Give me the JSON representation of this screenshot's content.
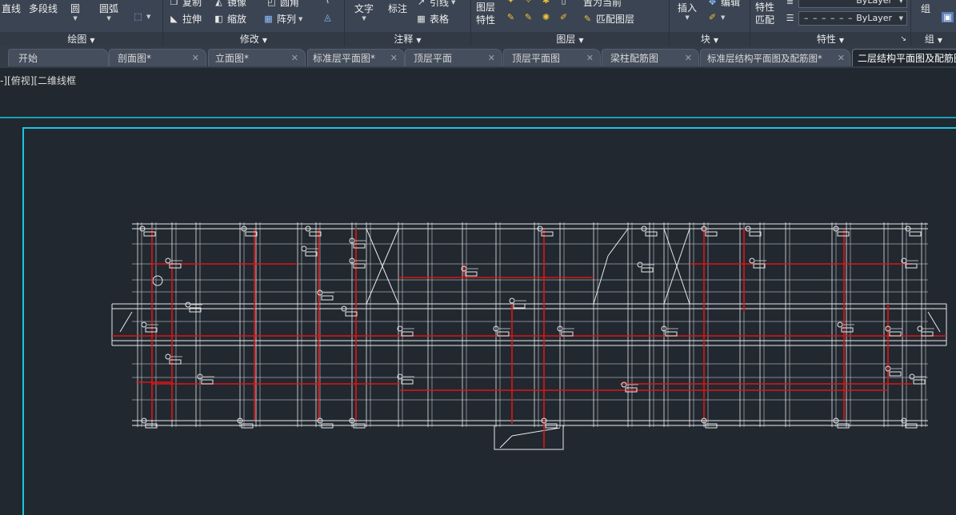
{
  "ribbon": {
    "draw": {
      "title": "绘图",
      "line": "直线",
      "polyline": "多段线",
      "circle": "圆",
      "arc": "圆弧"
    },
    "modify": {
      "title": "修改",
      "copy": "复制",
      "mirror": "镜像",
      "fillet": "圆角",
      "stretch": "拉伸",
      "scale": "缩放",
      "array": "阵列"
    },
    "annotation": {
      "title": "注释",
      "text": "文字",
      "dimension": "标注",
      "leader": "引线",
      "table": "表格"
    },
    "layers": {
      "title": "图层",
      "properties_line1": "图层",
      "properties_line2": "特性",
      "set_current": "置为当前",
      "match_layer": "匹配图层"
    },
    "block": {
      "title": "块",
      "insert": "插入",
      "edit": "编辑"
    },
    "properties": {
      "title": "特性",
      "match_line1": "特性",
      "match_line2": "匹配",
      "color_value": "ByLayer",
      "linetype_value": "ByLayer"
    },
    "groups": {
      "title": "组",
      "group": "组"
    }
  },
  "tabs": [
    {
      "label": "开始",
      "closable": false,
      "active": false
    },
    {
      "label": "剖面图*",
      "closable": true,
      "active": false
    },
    {
      "label": "立面图*",
      "closable": true,
      "active": false
    },
    {
      "label": "标准层平面图*",
      "closable": true,
      "active": false
    },
    {
      "label": "顶层平面",
      "closable": true,
      "active": false
    },
    {
      "label": "顶层平面图",
      "closable": true,
      "active": false
    },
    {
      "label": "梁柱配筋图",
      "closable": true,
      "active": false
    },
    {
      "label": "标准层结构平面图及配筋图*",
      "closable": true,
      "active": false
    },
    {
      "label": "二层结构平面图及配筋图",
      "closable": false,
      "active": true
    }
  ],
  "viewport": {
    "label": "-][俯视][二维线框"
  },
  "colors": {
    "background": "#212830",
    "frame": "#17c8e0",
    "wall": "#e8e8e8",
    "beam_red": "#e01414",
    "ribbon": "#3b4452",
    "tab_active": "#212830"
  },
  "icons": {
    "tab_close": "close-icon"
  }
}
